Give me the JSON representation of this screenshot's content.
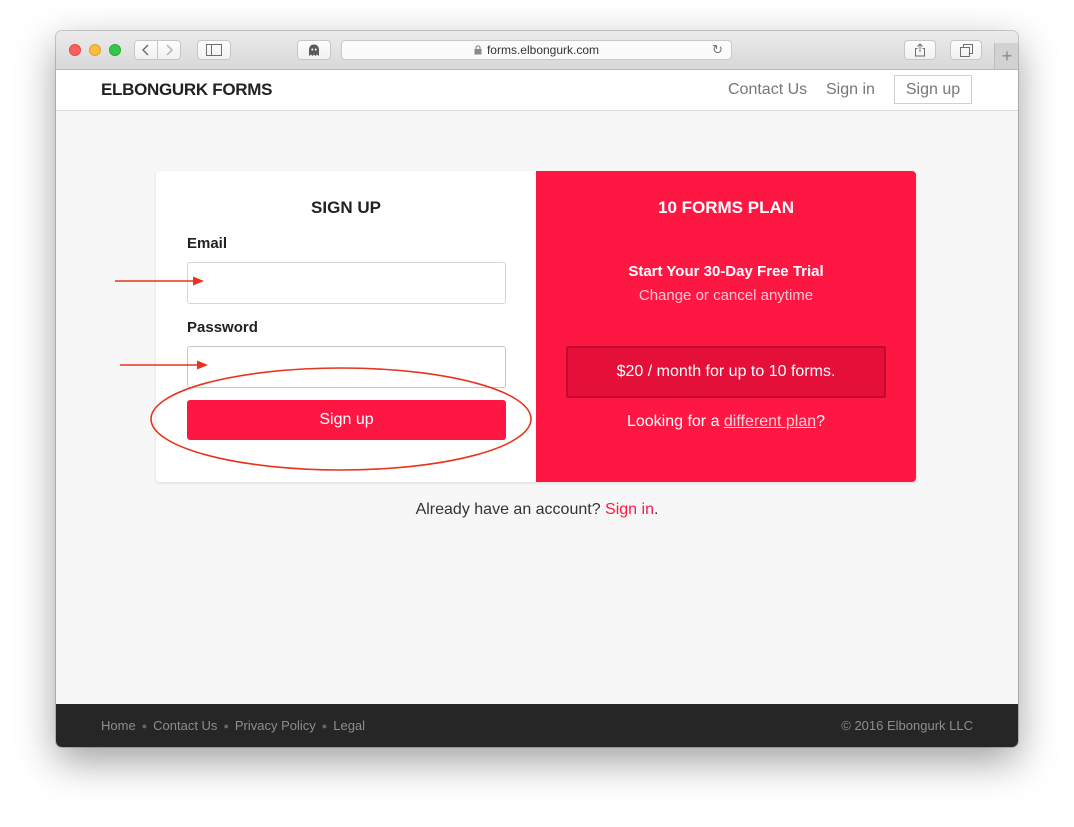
{
  "browser": {
    "url": "forms.elbongurk.com"
  },
  "header": {
    "brand": "ELBONGURK FORMS",
    "contact": "Contact Us",
    "signin": "Sign in",
    "signup": "Sign up"
  },
  "form": {
    "title": "SIGN UP",
    "email_label": "Email",
    "password_label": "Password",
    "submit": "Sign up"
  },
  "plan": {
    "title": "10 FORMS PLAN",
    "trial": "Start Your 30-Day Free Trial",
    "cancel": "Change or cancel anytime",
    "price": "$20 / month for up to 10 forms.",
    "looking_prefix": "Looking for a ",
    "looking_link": "different plan",
    "looking_suffix": "?"
  },
  "already": {
    "text": "Already have an account? ",
    "link": "Sign in",
    "suffix": "."
  },
  "footer": {
    "links": [
      "Home",
      "Contact Us",
      "Privacy Policy",
      "Legal"
    ],
    "copyright": "© 2016 Elbongurk LLC"
  },
  "colors": {
    "brand_red": "#ff1744",
    "annotation_red": "#e8341c"
  }
}
